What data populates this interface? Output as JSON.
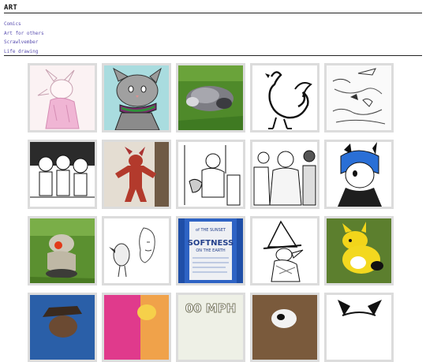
{
  "header": {
    "title": "ART"
  },
  "nav": [
    {
      "label": "Comics"
    },
    {
      "label": "Art for others"
    },
    {
      "label": "Scrawlvember"
    },
    {
      "label": "Life drawing"
    }
  ],
  "gallery": {
    "row4_texts": {
      "mph": "00 MPH"
    },
    "bottle_texts": {
      "t1": "of THE SUNSET",
      "t2": "SOFTNESS",
      "t3": "ON THE EARTH"
    }
  },
  "colors": {
    "link": "#5a4fb0",
    "rule": "#222222",
    "tile_border": "#dcdcdc"
  }
}
